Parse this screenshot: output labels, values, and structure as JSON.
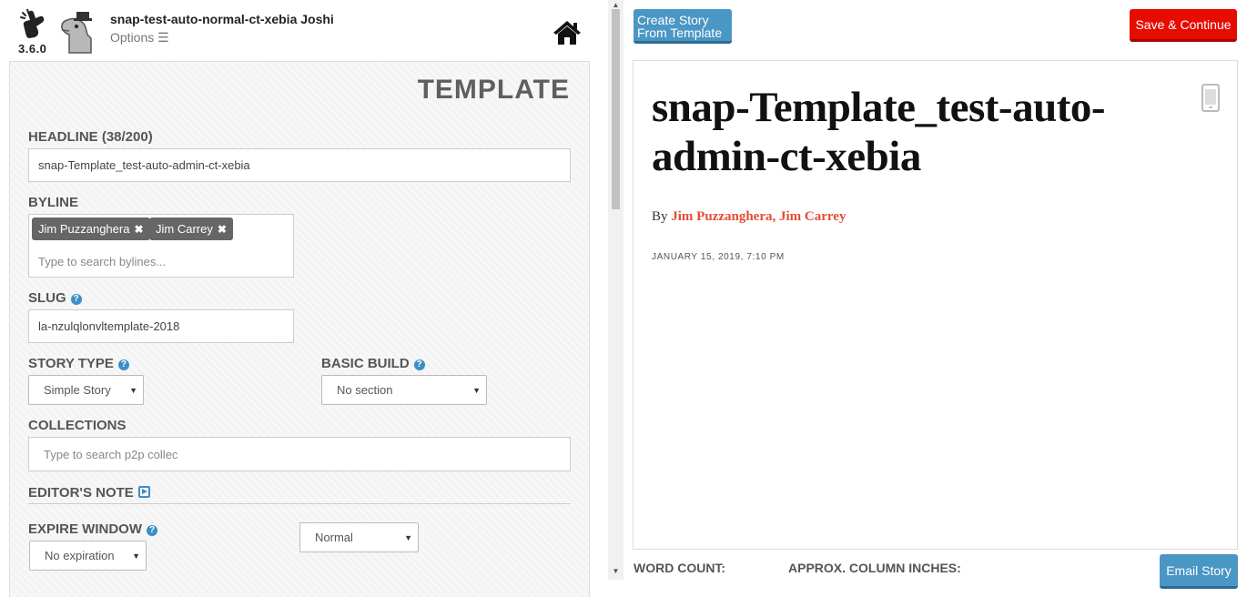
{
  "header": {
    "version": "3.6.0",
    "user_name": "snap-test-auto-normal-ct-xebia Joshi",
    "options_label": "Options ☰",
    "home_icon": "home-icon"
  },
  "form": {
    "title": "TEMPLATE",
    "headline": {
      "label": "HEADLINE (38/200)",
      "value": "snap-Template_test-auto-admin-ct-xebia"
    },
    "byline": {
      "label": "BYLINE",
      "tags": [
        "Jim Puzzanghera",
        "Jim Carrey"
      ],
      "placeholder": "Type to search bylines..."
    },
    "slug": {
      "label": "SLUG",
      "value": "la-nzulqlonvltemplate-2018"
    },
    "story_type": {
      "label": "STORY TYPE",
      "value": "Simple Story"
    },
    "basic_build": {
      "label": "BASIC BUILD",
      "value": "No section"
    },
    "collections": {
      "label": "COLLECTIONS",
      "placeholder": "Type to search p2p collec"
    },
    "editors_note": {
      "label": "EDITOR'S NOTE"
    },
    "expire_window": {
      "label": "EXPIRE WINDOW",
      "value": "No expiration"
    },
    "priority": {
      "value": "Normal"
    }
  },
  "toolbar": {
    "create_from_template": "Create Story From Template",
    "save_continue": "Save & Continue",
    "email_story": "Email Story"
  },
  "preview": {
    "headline": "snap-Template_test-auto-admin-ct-xebia",
    "by_prefix": "By",
    "authors": "Jim Puzzanghera, Jim Carrey",
    "date": "JANUARY 15, 2019, 7:10 PM"
  },
  "footer": {
    "word_count_label": "WORD COUNT:",
    "column_inches_label": "APPROX. COLUMN INCHES:"
  },
  "colors": {
    "accent_blue": "#4a96c4",
    "save_red": "#e60c00",
    "byline_red": "#e34b38"
  }
}
